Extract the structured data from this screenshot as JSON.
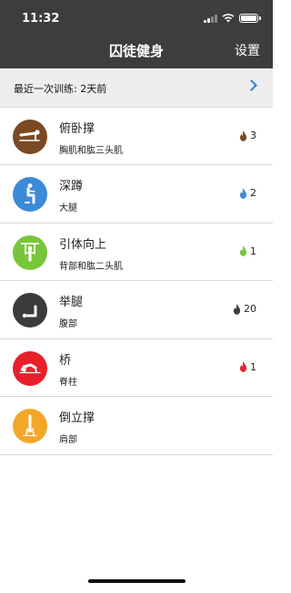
{
  "status_bar": {
    "time": "11:32"
  },
  "nav": {
    "title": "囚徒健身",
    "settings_label": "设置"
  },
  "last_training": {
    "text": "最近一次训练: 2天前"
  },
  "exercises": [
    {
      "title": "俯卧撑",
      "subtitle": "胸肌和肱三头肌",
      "level": "3",
      "color": "#7a4a23",
      "icon": "pushup-icon"
    },
    {
      "title": "深蹲",
      "subtitle": "大腿",
      "level": "2",
      "color": "#3d8ad8",
      "icon": "squat-icon"
    },
    {
      "title": "引体向上",
      "subtitle": "背部和肱二头肌",
      "level": "1",
      "color": "#79c53a",
      "icon": "pullup-icon"
    },
    {
      "title": "举腿",
      "subtitle": "腹部",
      "level": "20",
      "color": "#3b3b3b",
      "icon": "leg-raise-icon"
    },
    {
      "title": "桥",
      "subtitle": "脊柱",
      "level": "1",
      "color": "#e8202c",
      "icon": "bridge-icon"
    },
    {
      "title": "倒立撑",
      "subtitle": "肩部",
      "level": "",
      "color": "#f2a72a",
      "icon": "handstand-icon"
    }
  ]
}
